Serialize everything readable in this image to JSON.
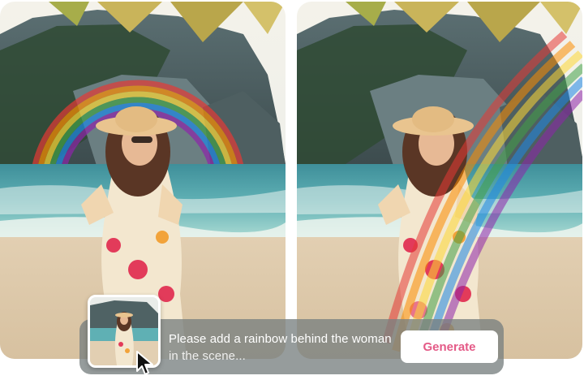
{
  "panels": {
    "before": {
      "image_name": "beach-woman-original"
    },
    "after": {
      "image_name": "beach-woman-rainbow-edit"
    }
  },
  "prompt": {
    "line1": "Please add a rainbow behind the woman",
    "line2": "in the scene..."
  },
  "generate_button": {
    "label": "Generate",
    "color": "#e45a87"
  },
  "thumbnail": {
    "image_name": "reference-thumbnail"
  },
  "cursor": {
    "icon": "pointer-cursor-icon"
  }
}
